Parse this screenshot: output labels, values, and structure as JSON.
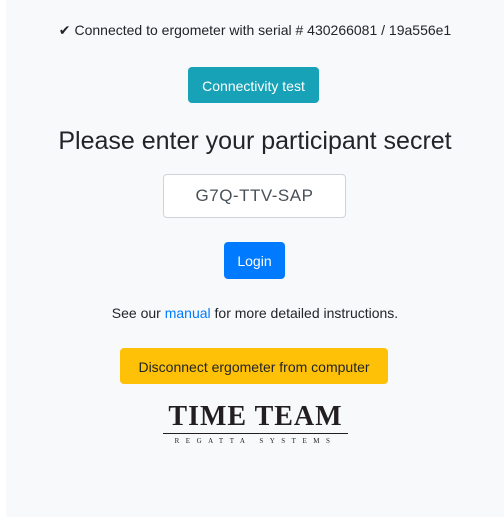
{
  "status": {
    "icon": "check-icon",
    "text": "Connected to ergometer with serial # 430266081 / 19a556e1"
  },
  "buttons": {
    "connectivity_test": "Connectivity test",
    "login": "Login",
    "disconnect": "Disconnect ergometer from computer"
  },
  "heading": "Please enter your participant secret",
  "secret_input": {
    "value": "G7Q-TTV-SAP"
  },
  "manual": {
    "prefix": "See our",
    "link": "manual",
    "suffix": "for more detailed instructions."
  },
  "logo": {
    "title": "TIME TEAM",
    "subtitle": "REGATTA SYSTEMS"
  },
  "colors": {
    "info": "#17a2b8",
    "primary": "#007bff",
    "warning": "#ffc107",
    "panel": "#f8f9fa"
  }
}
